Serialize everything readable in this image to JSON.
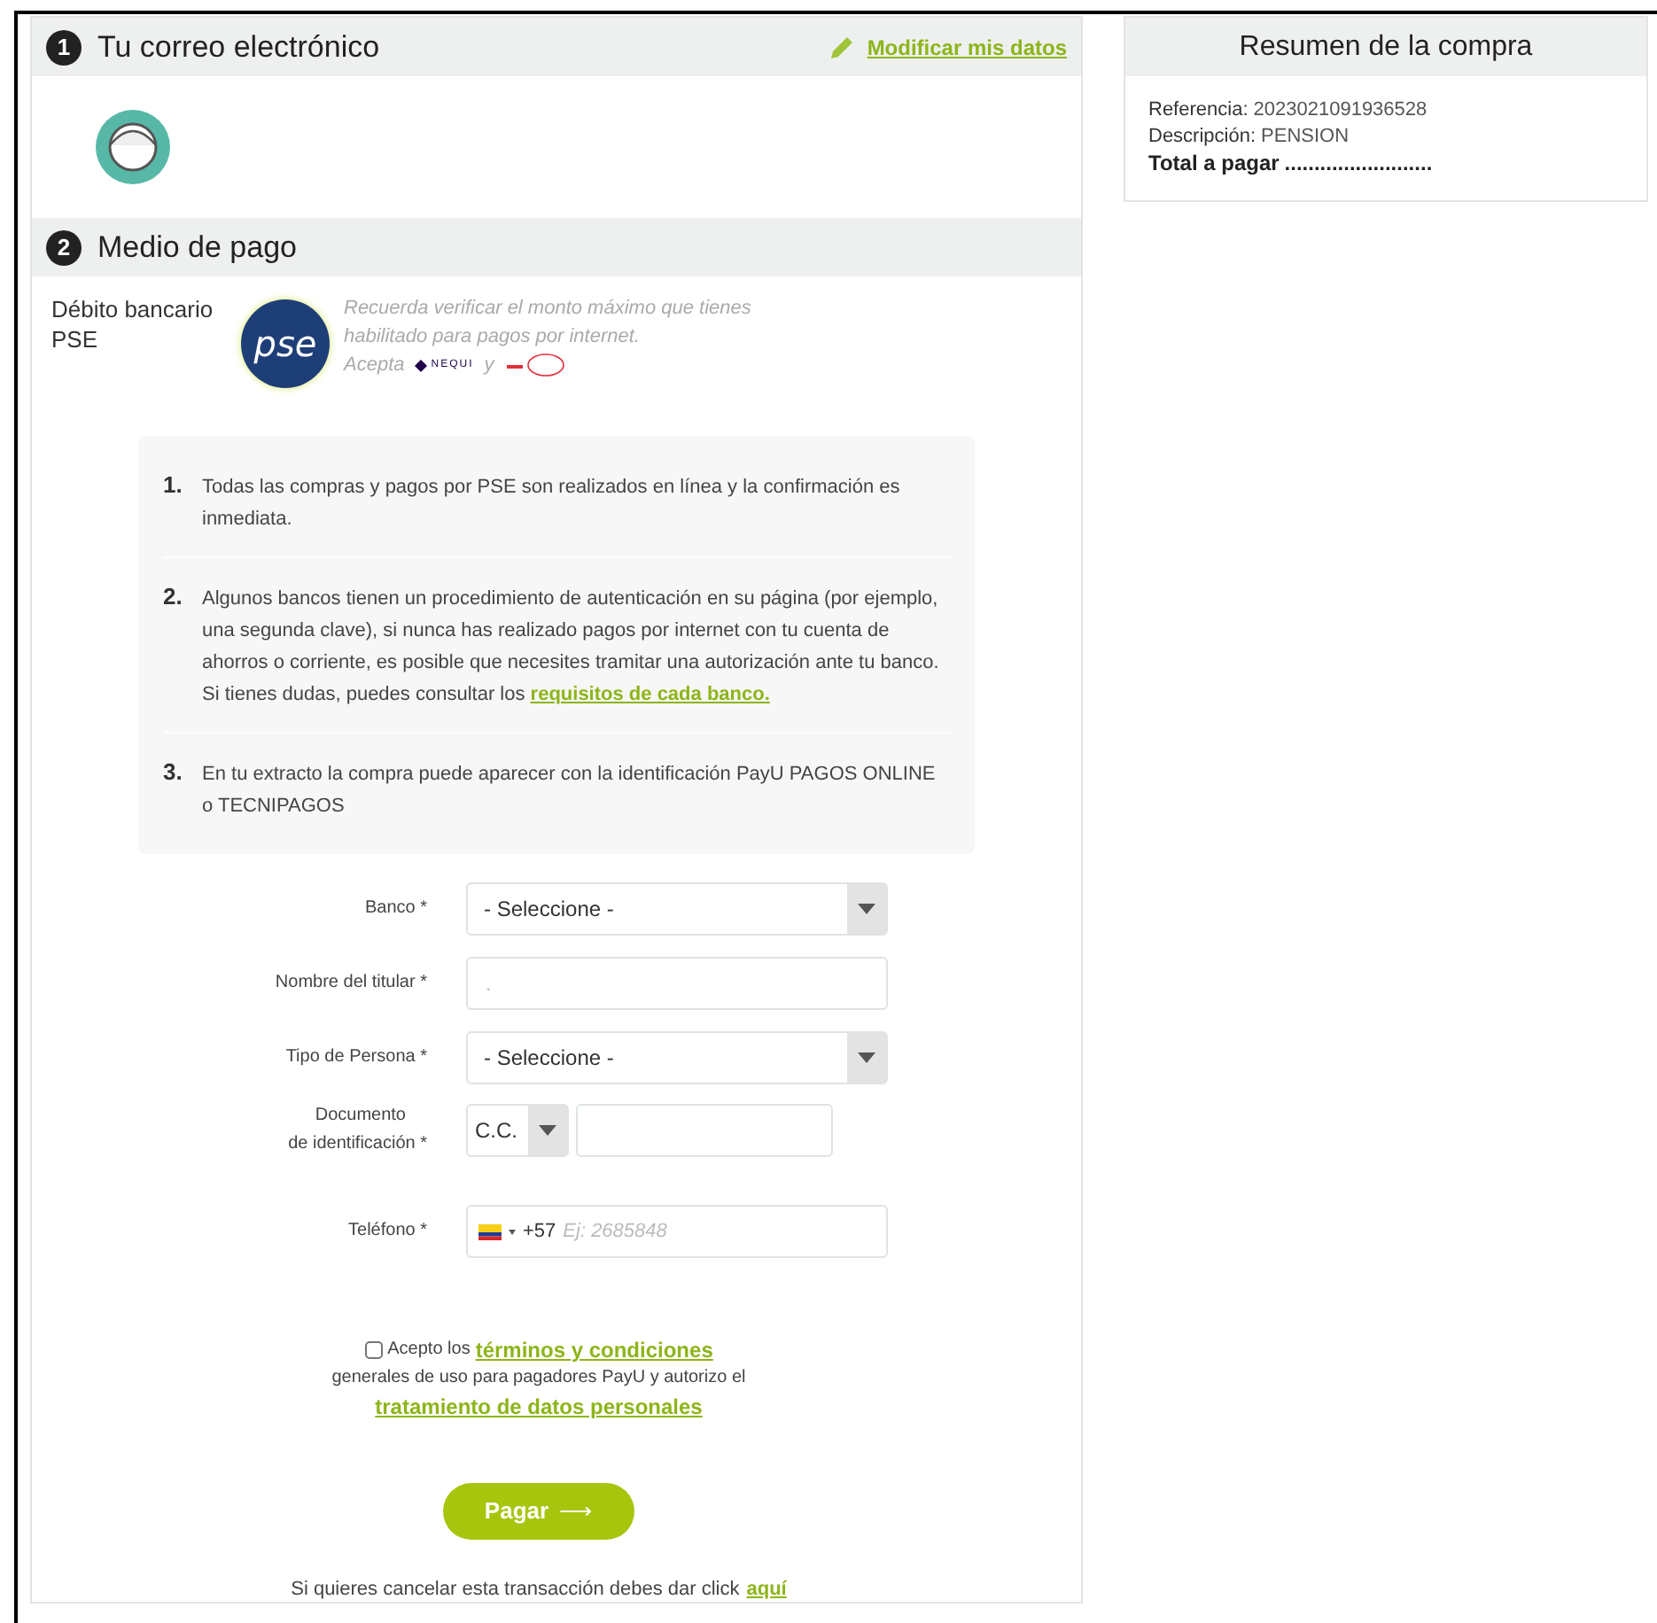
{
  "email_section": {
    "number": "1",
    "title": "Tu correo electrónico",
    "edit_link": "Modificar mis datos"
  },
  "payment_section": {
    "number": "2",
    "title": "Medio de pago",
    "method": "Débito bancario PSE",
    "logo_text": "pse",
    "notice": "Recuerda verificar el monto máximo que tienes habilitado para pagos por internet.",
    "accepts": "Acepta",
    "nequi": "NEQUI",
    "and": "y"
  },
  "steps": [
    {
      "number": "1.",
      "text": "Todas las compras y pagos por PSE son realizados en línea y la confirmación es inmediata."
    },
    {
      "number": "2.",
      "text": "Algunos bancos tienen un procedimiento de autenticación en su página (por ejemplo, una segunda clave), si nunca has realizado pagos por internet con tu cuenta de ahorros o corriente, es posible que necesites tramitar una autorización ante tu banco. Si tienes dudas, puedes consultar los",
      "link": "requisitos de cada banco."
    },
    {
      "number": "3.",
      "text": "En tu extracto la compra puede aparecer con la identificación PayU PAGOS ONLINE o TECNIPAGOS"
    }
  ],
  "form": [
    {
      "kind": "select",
      "label": "Banco *",
      "value": "- Seleccione -"
    },
    {
      "kind": "text",
      "label": "Nombre del titular *",
      "placeholder": "."
    },
    {
      "kind": "select",
      "label": "Tipo de Persona  *",
      "value": "- Seleccione -"
    },
    {
      "kind": "document",
      "label": "Documento",
      "label2": "de identificación  *",
      "doc_type": "C.C."
    },
    {
      "kind": "phone",
      "label": "Teléfono  *",
      "prefix": "+57",
      "placeholder": "Ej: 2685848"
    }
  ],
  "terms": {
    "checked": false,
    "before": "Acepto los",
    "link1": "términos y condiciones",
    "middle": "generales de uso para pagadores PayU y autorizo el",
    "link2": "tratamiento de datos personales"
  },
  "pay_button": {
    "label": "Pagar",
    "arrow": "⟶"
  },
  "cancel": {
    "text": "Si quieres cancelar esta transacción debes dar click",
    "link": "aquí"
  },
  "summary": {
    "title": "Resumen de la compra",
    "rows": [
      {
        "label": "Referencia:",
        "value": "2023021091936528"
      },
      {
        "label": "Descripción:",
        "value": "PENSION"
      },
      {
        "label": "Total a pagar",
        "value": "........................."
      }
    ]
  }
}
